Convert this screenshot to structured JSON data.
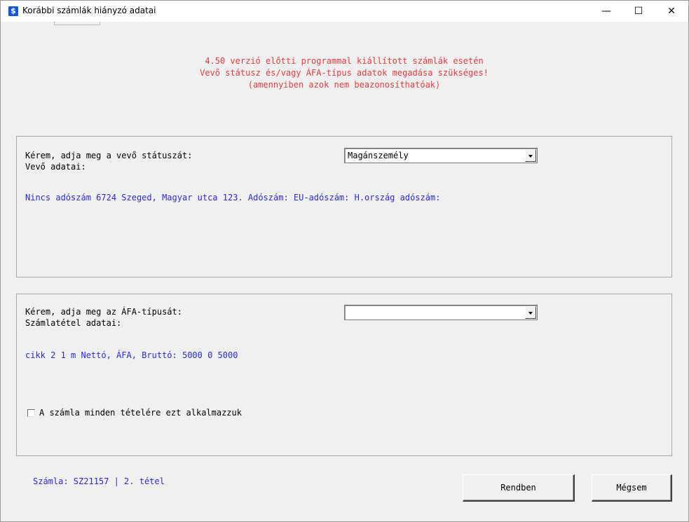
{
  "window": {
    "app_icon_glyph": "$",
    "title": "Korábbi számlák hiányzó adatai",
    "minimize_glyph": "—",
    "maximize_glyph": "☐",
    "close_glyph": "✕"
  },
  "notice": {
    "line1": "4.50 verzió előtti programmal kiállított számlák esetén",
    "line2": "Vevő státusz és/vagy ÁFA-típus adatok megadása szükséges!",
    "line3": "(amennyiben azok nem beazonosíthatóak)",
    "color": "#f03a3a"
  },
  "buyer_group": {
    "prompt": "Kérem, adja meg a vevő státuszát:",
    "data_label": "Vevő adatai:",
    "status_select_value": "Magánszemély",
    "buyer_details": "Nincs adószám  6724 Szeged, Magyar utca 123. Adószám:  EU-adószám:  H.ország adószám:"
  },
  "vat_group": {
    "prompt": "Kérem, adja meg az ÁFA-típusát:",
    "data_label": "Számlatétel adatai:",
    "vat_select_value": "",
    "item_details": "cikk 2 1 m Nettó, ÁFA, Bruttó: 5000 0 5000",
    "apply_all_label": "A számla minden tételére ezt alkalmazzuk",
    "apply_all_checked": false
  },
  "footer": {
    "invoice_info": "Számla: SZ21157 | 2. tétel",
    "ok_label": "Rendben",
    "cancel_label": "Mégsem"
  },
  "colors": {
    "info_blue": "#2a2ae0",
    "background": "#f0f0f0"
  }
}
